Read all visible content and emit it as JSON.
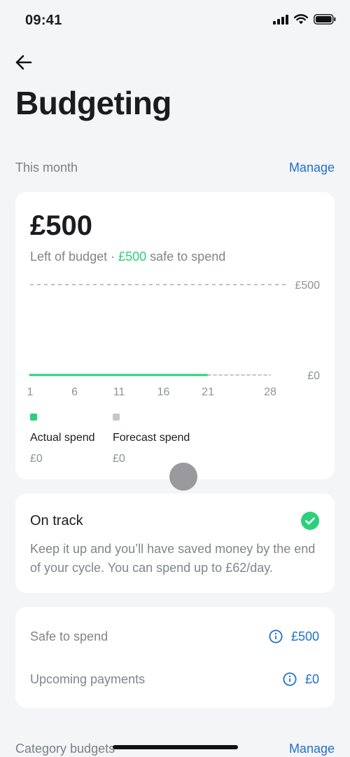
{
  "status": {
    "time": "09:41"
  },
  "title": "Budgeting",
  "this_month": {
    "label": "This month",
    "manage": "Manage"
  },
  "budget": {
    "amount": "£500",
    "left_text": "Left of budget · ",
    "safe_amount": "£500",
    "safe_text": " safe to spend"
  },
  "chart_data": {
    "type": "line",
    "x_ticks": [
      "1",
      "6",
      "11",
      "16",
      "21",
      "28"
    ],
    "y_ticks": [
      "£500",
      "£0"
    ],
    "xlim": [
      1,
      28
    ],
    "ylim": [
      0,
      500
    ],
    "series": [
      {
        "name": "Actual spend",
        "x": [
          1,
          21
        ],
        "y": [
          0,
          0
        ],
        "color": "#2bd07a"
      },
      {
        "name": "Forecast spend",
        "x": [
          21,
          28
        ],
        "y": [
          0,
          0
        ],
        "color": "#c3c7cd"
      }
    ],
    "budget_line": 500
  },
  "legend": [
    {
      "name": "Actual spend",
      "value": "£0",
      "color": "#2bd07a"
    },
    {
      "name": "Forecast spend",
      "value": "£0",
      "color": "#c3c7cd"
    }
  ],
  "on_track": {
    "title": "On track",
    "body": "Keep it up and you’ll have saved money by the end of your cycle. You can spend up to £62/day."
  },
  "summary": [
    {
      "label": "Safe to spend",
      "value": "£500"
    },
    {
      "label": "Upcoming payments",
      "value": "£0"
    }
  ],
  "category": {
    "label": "Category budgets",
    "manage": "Manage"
  },
  "colors": {
    "accent": "#1f6fd1",
    "green": "#2bd07a",
    "background": "#f4f5f7"
  }
}
